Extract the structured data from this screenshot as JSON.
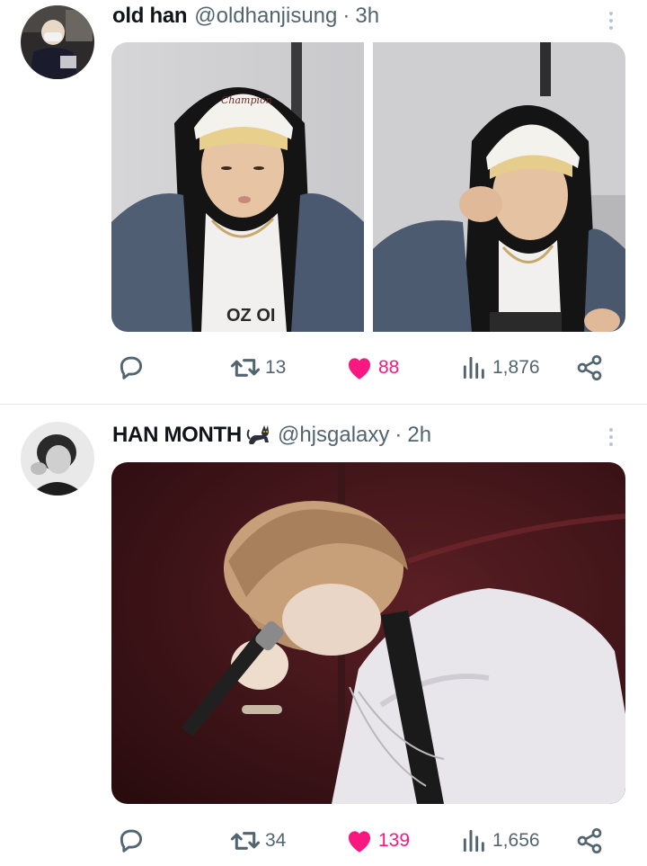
{
  "tweets": [
    {
      "display_name": "old han",
      "handle": "@oldhanjisung",
      "separator": "·",
      "time": "3h",
      "media_count": 2,
      "media_text": "OZ OI",
      "logo_text": "Champion",
      "actions": {
        "reply_count": "",
        "retweet_count": "13",
        "like_count": "88",
        "like_active": true,
        "views_count": "1,876"
      }
    },
    {
      "display_name": "HAN MONTH",
      "name_emoji": "cat-icon",
      "handle": "@hjsgalaxy",
      "separator": "·",
      "time": "2h",
      "media_count": 1,
      "actions": {
        "reply_count": "",
        "retweet_count": "34",
        "like_count": "139",
        "like_active": true,
        "views_count": "1,656"
      }
    }
  ],
  "colors": {
    "text_primary": "#0f1419",
    "text_secondary": "#536471",
    "like_active": "#f91880",
    "divider": "#e4e8eb"
  }
}
